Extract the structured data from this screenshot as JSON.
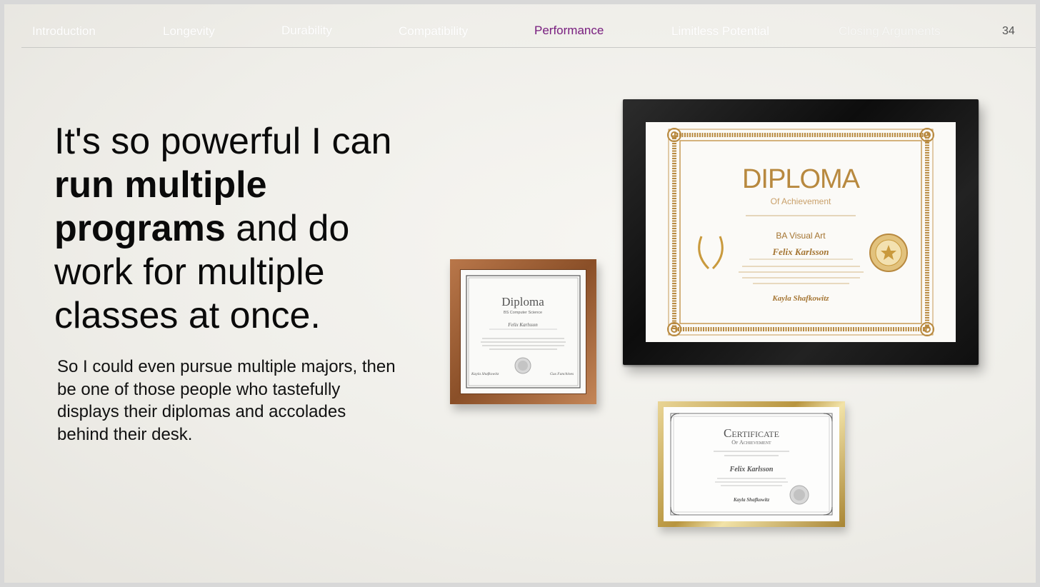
{
  "nav": {
    "items": [
      {
        "label": "Introduction"
      },
      {
        "label": "Longevity"
      },
      {
        "label": "Durability"
      },
      {
        "label": "Compatibility"
      },
      {
        "label": "Performance"
      },
      {
        "label": "Limitless Potential"
      },
      {
        "label": "Closing Arguments"
      }
    ],
    "active": "Performance",
    "page_number": "34"
  },
  "headline": {
    "part1": "It's so powerful I can ",
    "bold1": "run multiple programs",
    "part2": " and do work for multiple classes at once."
  },
  "body_text": "So I could even pursue multiple majors, then be one of those people who tastefully displays their diplomas and accolades behind their desk.",
  "certificates": {
    "large": {
      "title": "DIPLOMA",
      "subtitle": "Of Achievement",
      "degree": "BA Visual Art",
      "name": "Felix Karlsson",
      "signature": "Kayla Shafkowitz"
    },
    "small": {
      "title": "Diploma",
      "degree": "BS Computer Science",
      "name": "Felix Karlsson",
      "signature_left": "Kayla Shafkowitz",
      "signature_right": "Gus Fanchines"
    },
    "gold": {
      "title": "Certificate",
      "subtitle": "Of Achievement",
      "name": "Felix Karlsson",
      "signature": "Kayla Shafkowitz"
    }
  },
  "colors": {
    "active_nav": "#7b2182",
    "gold": "#b8893f"
  }
}
